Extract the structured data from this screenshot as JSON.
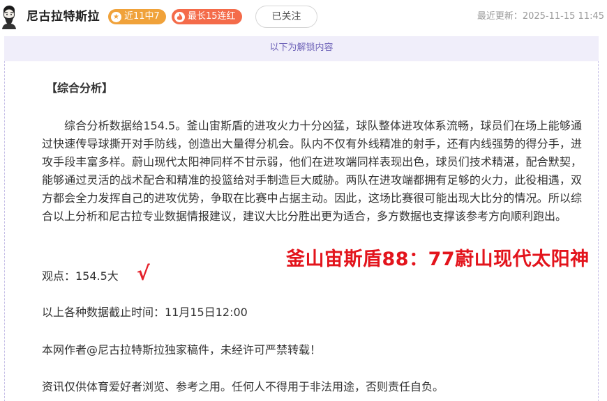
{
  "header": {
    "author": "尼古拉特斯拉",
    "badge_hit": "近11中7",
    "badge_streak": "最长15连红",
    "follow_label": "已关注",
    "update_label": "最近更新：",
    "update_time": "2025-11-15 11:45"
  },
  "unlock": {
    "notice": "以下为解锁内容"
  },
  "article": {
    "section_title": "【综合分析】",
    "analysis": "综合分析数据给154.5。釜山宙斯盾的进攻火力十分凶猛，球队整体进攻体系流畅，球员们在场上能够通过快速传导球撕开对手防线，创造出大量得分机会。队内不仅有外线精准的射手，还有内线强势的得分手，进攻手段丰富多样。蔚山现代太阳神同样不甘示弱，他们在进攻端同样表现出色，球员们技术精湛，配合默契，能够通过灵活的战术配合和精准的投篮给对手制造巨大威胁。两队在进攻端都拥有足够的火力，此役相遇，双方都会全力发挥自己的进攻优势，争取在比赛中占据主动。因此，这场比赛很可能出现大比分的情况。所以综合以上分析和尼古拉专业数据情报建议，建议大比分胜出更为适合，多方数据也支撑该参考方向顺利跑出。",
    "viewpoint": "观点：154.5大",
    "check_mark": "√",
    "score_stamp": "釜山宙斯盾88：77蔚山现代太阳神",
    "cutoff": "以上各种数据截止时间：11月15日12:00",
    "copyright": "本网作者@尼古拉特斯拉独家稿件，未经许可严禁转载！",
    "disclaimer": "资讯仅供体育爱好者浏览、参考之用。任何人不得用于非法用途，否则责任自负。"
  },
  "colors": {
    "hit_badge": "#f0a23a",
    "streak_badge": "#f46b4a",
    "unlock_bg": "#f0eefa",
    "unlock_text": "#6e63b8",
    "stamp_red": "#e3141c"
  },
  "icons": {
    "avatar": "bearded-man-avatar",
    "hit_badge": "star-icon",
    "streak_badge": "flame-icon"
  }
}
